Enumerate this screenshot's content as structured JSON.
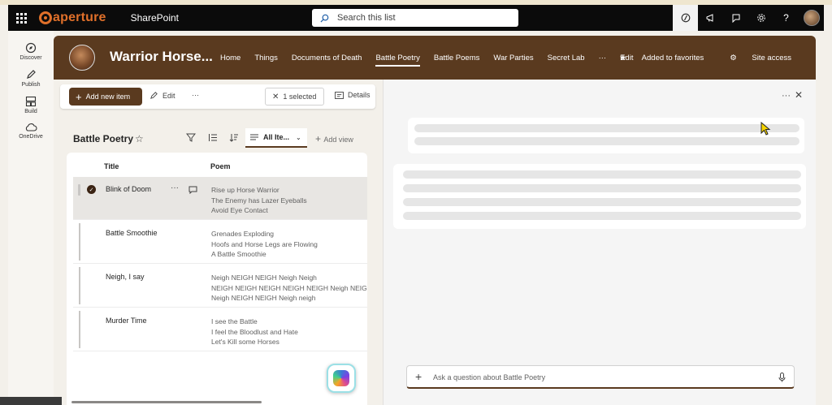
{
  "suite": {
    "brand": "aperture",
    "app": "SharePoint",
    "search_placeholder": "Search this list"
  },
  "rail": {
    "items": [
      {
        "label": "Discover",
        "icon": "compass-icon"
      },
      {
        "label": "Publish",
        "icon": "pen-icon"
      },
      {
        "label": "Build",
        "icon": "build-icon"
      },
      {
        "label": "OneDrive",
        "icon": "cloud-icon"
      }
    ]
  },
  "site": {
    "title": "Warrior Horse...",
    "nav": [
      "Home",
      "Things",
      "Documents of Death",
      "Battle Poetry",
      "Battle Poems",
      "War Parties",
      "Secret Lab",
      "···",
      "Edit"
    ],
    "active_nav": "Battle Poetry",
    "favorite": "Added to favorites",
    "access": "Site access"
  },
  "cmdbar": {
    "add": "Add new item",
    "edit": "Edit",
    "more": "···",
    "selected": "1 selected",
    "details": "Details"
  },
  "list": {
    "title": "Battle Poetry",
    "view": "All Ite...",
    "add_view": "Add view",
    "columns": {
      "title": "Title",
      "poem": "Poem"
    },
    "rows": [
      {
        "title": "Blink of Doom",
        "lines": [
          "Rise up Horse Warrior",
          "The Enemy has Lazer Eyeballs",
          "Avoid Eye Contact"
        ],
        "selected": true
      },
      {
        "title": "Battle Smoothie",
        "lines": [
          "Grenades Exploding",
          "Hoofs and Horse Legs are Flowing",
          "A Battle Smoothie"
        ],
        "selected": false
      },
      {
        "title": "Neigh, I say",
        "lines": [
          "Neigh NEIGH NEIGH Neigh Neigh",
          "NEIGH NEIGH NEIGH NEIGH NEIGH Neigh NEIG",
          "Neigh NEIGH NEIGH Neigh neigh"
        ],
        "selected": false
      },
      {
        "title": "Murder Time",
        "lines": [
          "I see the Battle",
          "I feel the Bloodlust and Hate",
          "Let's Kill some Horses"
        ],
        "selected": false
      }
    ]
  },
  "copilot": {
    "more": "···",
    "ask_placeholder": "Ask a question about Battle Poetry"
  }
}
